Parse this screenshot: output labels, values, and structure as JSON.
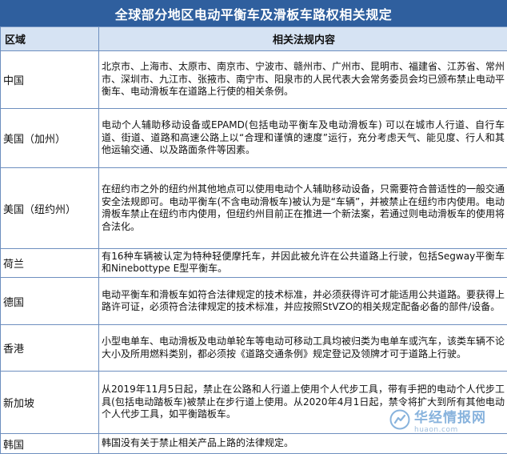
{
  "title": "全球部分地区电动平衡车及滑板车路权相关规定",
  "table": {
    "headers": {
      "region": "区域",
      "law": "相关法规内容"
    },
    "rows": [
      {
        "region": "中国",
        "law": "北京市、上海市、太原市、南京市、宁波市、赣州市、广州市、昆明市、福建省、江苏省、常州市、深圳市、九江市、张掖市、南宁市、阳泉市的人民代表大会常务委员会均已颁布禁止电动平衡车、电动滑板车在道路上行使的相关条例。"
      },
      {
        "region": "美国（加州）",
        "law": "电动个人辅助移动设备或EPAMD(包括电动平衡车及电动滑板车) 可以在城市人行道、自行车道、街道、道路和高速公路上以“合理和谨慎的速度”运行，充分考虑天气、能见度、行人和其他运输交通、以及路面条件等因素。"
      },
      {
        "region": "美国（纽约州）",
        "law": "在纽约市之外的纽约州其他地点可以使用电动个人辅助移动设备，只需要符合普适性的一般交通安全法规即可。电动平衡车(不含电动滑板车)被认为是“车辆”，并被禁止在纽约市内使用。电动滑板车禁止在纽约市内使用，但纽约州目前正在推进一个新法案，若通过则电动滑板车的使用将合法化。"
      },
      {
        "region": "荷兰",
        "law": "有16种车辆被认定为特种轻便摩托车，并因此被允许在公共道路上行驶，包括Segway平衡车和Ninebottype E型平衡车。"
      },
      {
        "region": "德国",
        "law": "电动平衡车和滑板车如符合法律规定的技术标准，并必须获得许可才能适用公共道路。要获得上路许可证，必须符合法律规定的技术标准，并应按照StVZO的相关规定配备必备的部件/设备。"
      },
      {
        "region": "香港",
        "law": "小型电单车、电动滑板及电动单轮车等电动可移动工具均被归类为电单车或汽车，该类车辆不论大小及所用燃料类别，都必须按《道路交通条例》规定登记及领牌才可于道路上行驶。"
      },
      {
        "region": "新加坡",
        "law": "从2019年11月5日起，禁止在公路和人行道上使用个人代步工具，带有手把的电动个人代步工具(包括电动踏板车)被禁止在步行道上使用。从2020年4月1日起，禁令将扩大到所有其他电动个人代步工具，如平衡踏板车。"
      },
      {
        "region": "韩国",
        "law": "韩国没有关于禁止相关产品上路的法律规定。"
      }
    ]
  },
  "watermark": {
    "name": "华经情报网",
    "url": "huaon.com",
    "color": "#6fa3d6"
  }
}
